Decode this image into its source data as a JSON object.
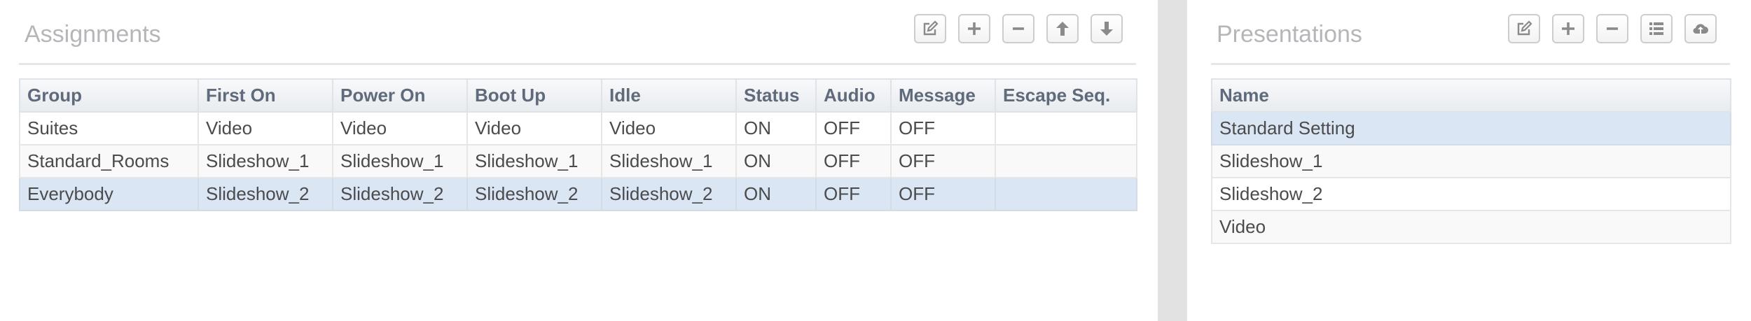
{
  "assignments": {
    "title": "Assignments",
    "toolbar": [
      {
        "icon": "edit-icon",
        "label": "Edit"
      },
      {
        "icon": "plus-icon",
        "label": "Add"
      },
      {
        "icon": "minus-icon",
        "label": "Remove"
      },
      {
        "icon": "arrow-up-icon",
        "label": "Move up"
      },
      {
        "icon": "arrow-down-icon",
        "label": "Move down"
      }
    ],
    "columns": [
      "Group",
      "First On",
      "Power On",
      "Boot Up",
      "Idle",
      "Status",
      "Audio",
      "Message",
      "Escape Seq."
    ],
    "rows": [
      {
        "selected": false,
        "cells": [
          "Suites",
          "Video",
          "Video",
          "Video",
          "Video",
          "ON",
          "OFF",
          "OFF",
          ""
        ]
      },
      {
        "selected": false,
        "cells": [
          "Standard_Rooms",
          "Slideshow_1",
          "Slideshow_1",
          "Slideshow_1",
          "Slideshow_1",
          "ON",
          "OFF",
          "OFF",
          ""
        ]
      },
      {
        "selected": true,
        "cells": [
          "Everybody",
          "Slideshow_2",
          "Slideshow_2",
          "Slideshow_2",
          "Slideshow_2",
          "ON",
          "OFF",
          "OFF",
          ""
        ]
      }
    ]
  },
  "presentations": {
    "title": "Presentations",
    "toolbar": [
      {
        "icon": "edit-icon",
        "label": "Edit"
      },
      {
        "icon": "plus-icon",
        "label": "Add"
      },
      {
        "icon": "minus-icon",
        "label": "Remove"
      },
      {
        "icon": "list-icon",
        "label": "List"
      },
      {
        "icon": "cloud-upload-icon",
        "label": "Upload"
      }
    ],
    "columns": [
      "Name"
    ],
    "rows": [
      {
        "selected": true,
        "cells": [
          "Standard Setting"
        ]
      },
      {
        "selected": false,
        "cells": [
          "Slideshow_1"
        ]
      },
      {
        "selected": false,
        "cells": [
          "Slideshow_2"
        ]
      },
      {
        "selected": false,
        "cells": [
          "Video"
        ]
      }
    ]
  },
  "colors": {
    "selected_row": "#dae6f4",
    "header_text": "#5f6b7b",
    "title_text": "#b4b6b9",
    "divider": "#e2e2e2"
  }
}
